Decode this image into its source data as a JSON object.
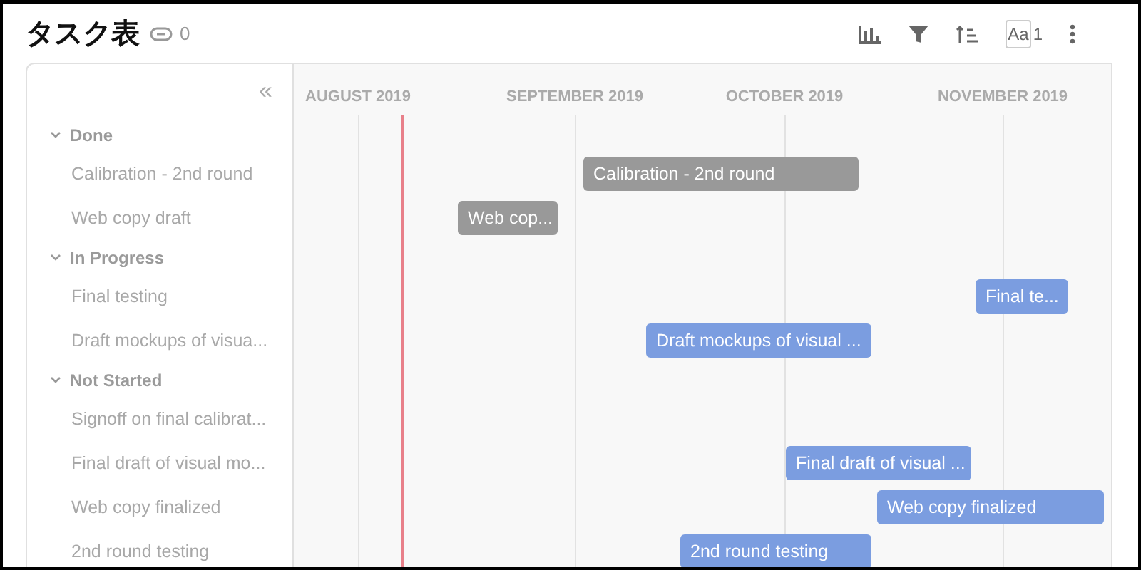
{
  "header": {
    "title": "タスク表",
    "link_count": "0",
    "font_label": "Aa",
    "font_count": "1"
  },
  "sidebar": {
    "collapse": "«"
  },
  "timeline": {
    "months": [
      "AUGUST 2019",
      "SEPTEMBER 2019",
      "OCTOBER 2019",
      "NOVEMBER 2019"
    ]
  },
  "groups": [
    {
      "name": "Done",
      "kind": "done",
      "expanded": true,
      "tasks": [
        {
          "name": "Calibration - 2nd round",
          "bar": "Calibration - 2nd round"
        },
        {
          "name": "Web copy draft",
          "bar": "Web cop..."
        }
      ]
    },
    {
      "name": "In Progress",
      "kind": "open",
      "expanded": true,
      "tasks": [
        {
          "name": "Final testing",
          "bar": "Final te..."
        },
        {
          "name": "Draft mockups of visua...",
          "bar": "Draft mockups of visual ..."
        }
      ]
    },
    {
      "name": "Not Started",
      "kind": "open",
      "expanded": true,
      "tasks": [
        {
          "name": "Signoff on final calibrat..."
        },
        {
          "name": "Final draft of visual mo...",
          "bar": "Final draft of visual ..."
        },
        {
          "name": "Web copy finalized",
          "bar": "Web copy finalized"
        },
        {
          "name": "2nd round testing",
          "bar": "2nd round testing"
        }
      ]
    }
  ]
}
